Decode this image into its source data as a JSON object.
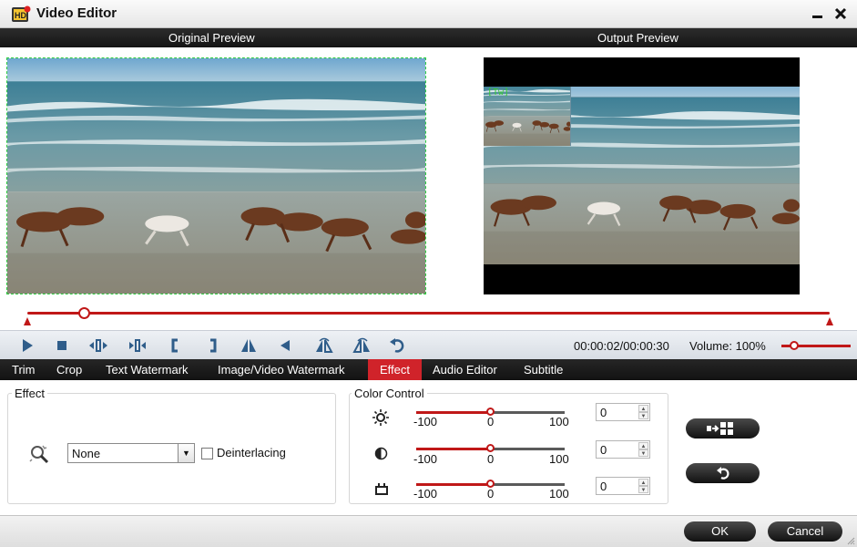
{
  "window": {
    "title": "Video Editor",
    "minimize_glyph": "▬",
    "close_glyph": "✕"
  },
  "preview": {
    "original_label": "Original Preview",
    "output_label": "Output Preview",
    "pip_tag": "[Tw]"
  },
  "playback": {
    "progress_fraction": 0.07,
    "time": "00:00:02/00:00:30",
    "volume_label": "Volume:",
    "volume_value": "100%",
    "volume_fraction": 0.19,
    "buttons": [
      "play-icon",
      "stop-icon",
      "prev-frame-icon",
      "next-frame-icon",
      "mark-in-icon",
      "mark-out-icon",
      "flip-vertical-icon",
      "rotate-left-icon",
      "flip-horizontal-icon",
      "rotate-right-icon",
      "reset-icon"
    ]
  },
  "tabs": [
    {
      "label": "Trim"
    },
    {
      "label": "Crop"
    },
    {
      "label": "Text Watermark"
    },
    {
      "label": "Image/Video Watermark"
    },
    {
      "label": "Effect",
      "active": true
    },
    {
      "label": "Audio Editor"
    },
    {
      "label": "Subtitle"
    }
  ],
  "effect": {
    "group_label": "Effect",
    "selected": "None",
    "deinterlacing_label": "Deinterlacing",
    "deinterlacing_checked": false,
    "icon": "effect-wand-icon"
  },
  "color_control": {
    "group_label": "Color Control",
    "sliders": [
      {
        "name": "brightness",
        "icon": "brightness-icon",
        "min": "-100",
        "mid": "0",
        "max": "100",
        "value": "0"
      },
      {
        "name": "contrast",
        "icon": "contrast-icon",
        "min": "-100",
        "mid": "0",
        "max": "100",
        "value": "0"
      },
      {
        "name": "saturation",
        "icon": "saturation-icon",
        "min": "-100",
        "mid": "0",
        "max": "100",
        "value": "0"
      }
    ]
  },
  "side_buttons": {
    "apply_to_all_icon": "apply-to-all-icon",
    "restore_icon": "restore-icon"
  },
  "footer": {
    "ok_label": "OK",
    "cancel_label": "Cancel"
  },
  "colors": {
    "accent": "#c01818",
    "active_tab": "#d0232a",
    "dark_bar": "#1a1a1a"
  }
}
